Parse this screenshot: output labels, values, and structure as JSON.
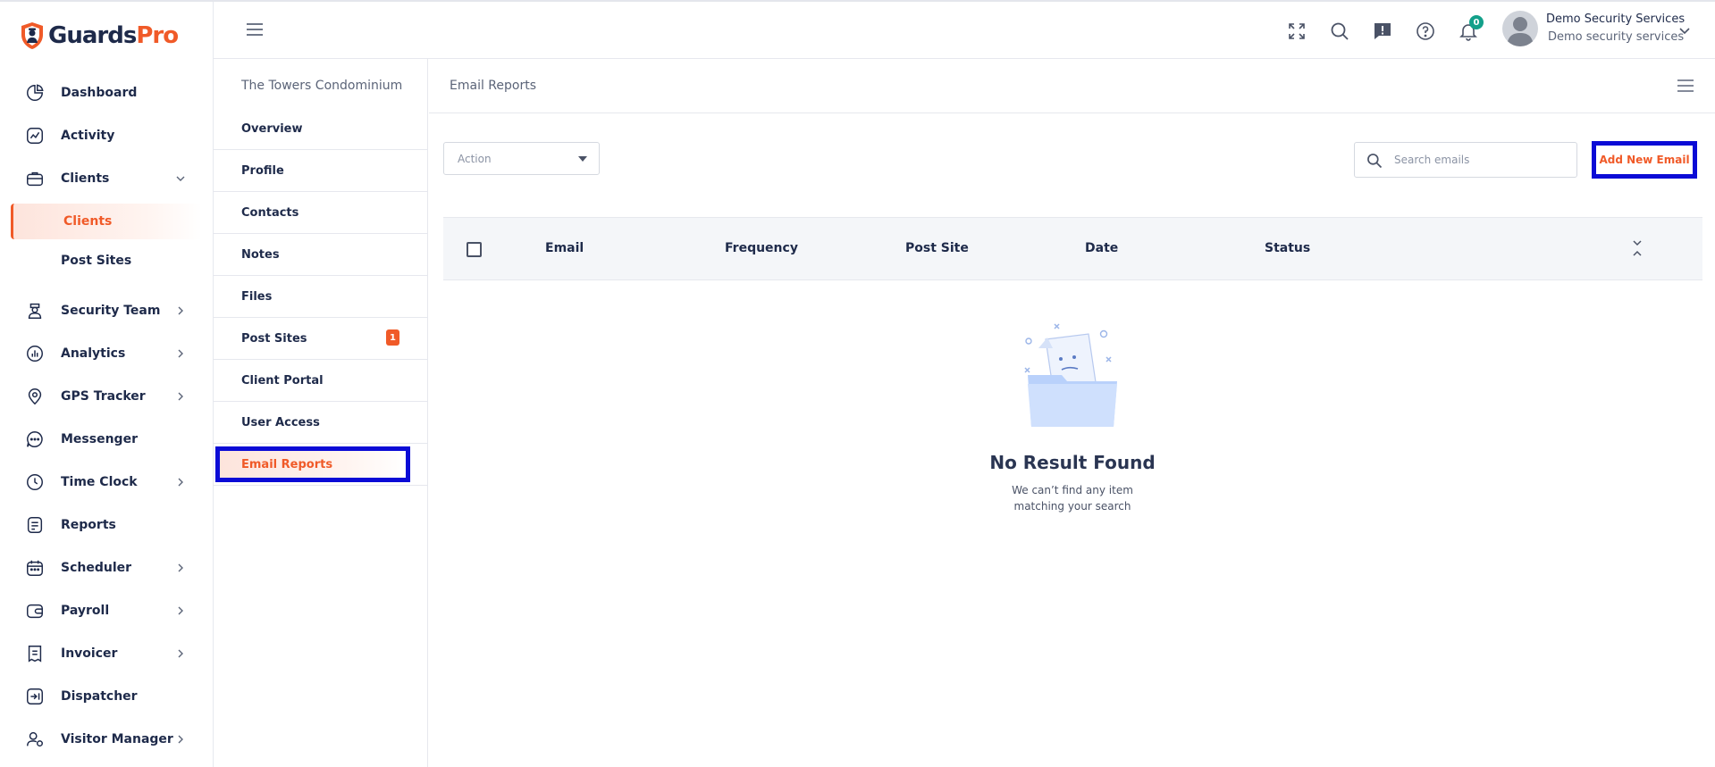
{
  "brand": {
    "part1": "Guards",
    "part2": "Pro"
  },
  "sidebar": {
    "items": [
      {
        "label": "Dashboard",
        "icon": "pie-chart-icon"
      },
      {
        "label": "Activity",
        "icon": "activity-icon"
      },
      {
        "label": "Clients",
        "icon": "briefcase-icon",
        "expanded": true
      },
      {
        "label": "Security Team",
        "icon": "guard-icon"
      },
      {
        "label": "Analytics",
        "icon": "analytics-icon"
      },
      {
        "label": "GPS Tracker",
        "icon": "location-pin-icon"
      },
      {
        "label": "Messenger",
        "icon": "chat-icon"
      },
      {
        "label": "Time Clock",
        "icon": "clock-icon"
      },
      {
        "label": "Reports",
        "icon": "document-icon"
      },
      {
        "label": "Scheduler",
        "icon": "calendar-icon"
      },
      {
        "label": "Payroll",
        "icon": "wallet-icon"
      },
      {
        "label": "Invoicer",
        "icon": "invoice-icon"
      },
      {
        "label": "Dispatcher",
        "icon": "dispatch-icon"
      },
      {
        "label": "Visitor Manager",
        "icon": "visitor-icon"
      }
    ],
    "sub_items": [
      {
        "label": "Clients",
        "active": true
      },
      {
        "label": "Post Sites",
        "active": false
      }
    ]
  },
  "header": {
    "user_name": "Demo Security Services",
    "user_company": "Demo security services",
    "notification_count": "0"
  },
  "subnav": {
    "title": "The Towers Condominium",
    "items": [
      {
        "label": "Overview"
      },
      {
        "label": "Profile"
      },
      {
        "label": "Contacts"
      },
      {
        "label": "Notes"
      },
      {
        "label": "Files"
      },
      {
        "label": "Post Sites",
        "badge": "1"
      },
      {
        "label": "Client Portal"
      },
      {
        "label": "User Access"
      },
      {
        "label": "Email Reports",
        "active": true
      }
    ]
  },
  "main": {
    "title": "Email Reports",
    "action_label": "Action",
    "search_placeholder": "Search emails",
    "add_button": "Add New Email",
    "columns": [
      "Email",
      "Frequency",
      "Post Site",
      "Date",
      "Status"
    ],
    "empty_title": "No Result Found",
    "empty_line1": "We can’t find any item",
    "empty_line2": "matching your search"
  },
  "colors": {
    "accent": "#f05a28",
    "navy": "#1e2a4a",
    "highlight": "#0b0bd6",
    "badge_green": "#13a08a"
  }
}
